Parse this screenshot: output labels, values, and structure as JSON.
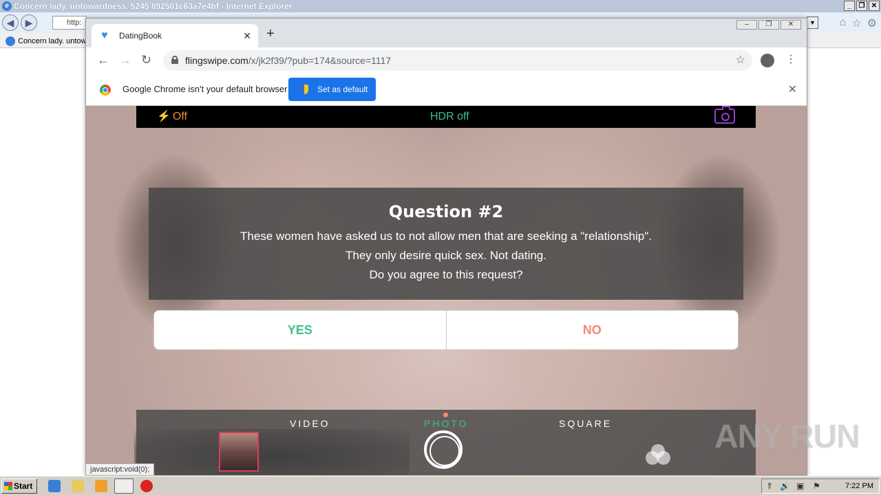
{
  "ie": {
    "title": "Concern lady. untowardness. 5245 892501c63a7e4bf - Internet Explorer",
    "address": "http:",
    "tab_label": "Concern lady. untow"
  },
  "chrome": {
    "tab_title": "DatingBook",
    "url_host": "flingswipe.com",
    "url_path": "/x/jk2f39/?pub=174&source=1117",
    "infobar_message": "Google Chrome isn't your default browser",
    "set_default_label": "Set as default"
  },
  "camera": {
    "flash_label": "Off",
    "hdr_label": "HDR off",
    "modes": [
      "VIDEO",
      "PHOTO",
      "SQUARE"
    ]
  },
  "question": {
    "title": "Question #2",
    "lines": [
      "These women have asked us to not allow men that are seeking a \"relationship\".",
      "They only desire quick sex. Not dating.",
      "Do you agree to this request?"
    ],
    "yes_label": "YES",
    "no_label": "NO"
  },
  "status_tip": "javascript:void(0);",
  "watermark": "ANY RUN",
  "taskbar": {
    "start_label": "Start",
    "clock": "7:22 PM"
  },
  "colors": {
    "accent_green": "#3ec08a",
    "accent_orange": "#f28c2c",
    "no_color": "#f28877",
    "chrome_blue": "#1a73e8"
  }
}
